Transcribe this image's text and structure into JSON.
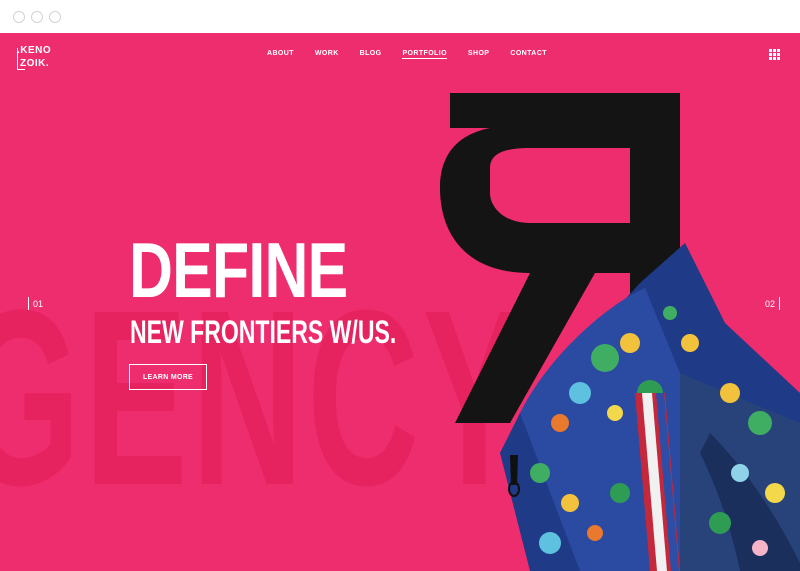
{
  "window": {
    "controls": [
      "close",
      "minimize",
      "maximize"
    ]
  },
  "brand": {
    "logo_line1": ".KENO",
    "logo_line2": "ZOIK."
  },
  "nav": {
    "items": [
      {
        "label": "ABOUT"
      },
      {
        "label": "WORK"
      },
      {
        "label": "BLOG"
      },
      {
        "label": "PORTFOLIO",
        "active": true
      },
      {
        "label": "SHOP"
      },
      {
        "label": "CONTACT"
      }
    ],
    "menu_icon": "grid-icon"
  },
  "hero": {
    "background_word": "GENCY",
    "headline": "DEFINE",
    "subheadline": "NEW FRONTIERS W/US.",
    "cta_label": "LEARN MORE",
    "slide_prev": "01",
    "slide_next": "02",
    "art_letter": "R"
  },
  "colors": {
    "accent": "#ee2d6e",
    "accent_dark": "#e6225f",
    "text": "#ffffff",
    "letter": "#141414"
  }
}
